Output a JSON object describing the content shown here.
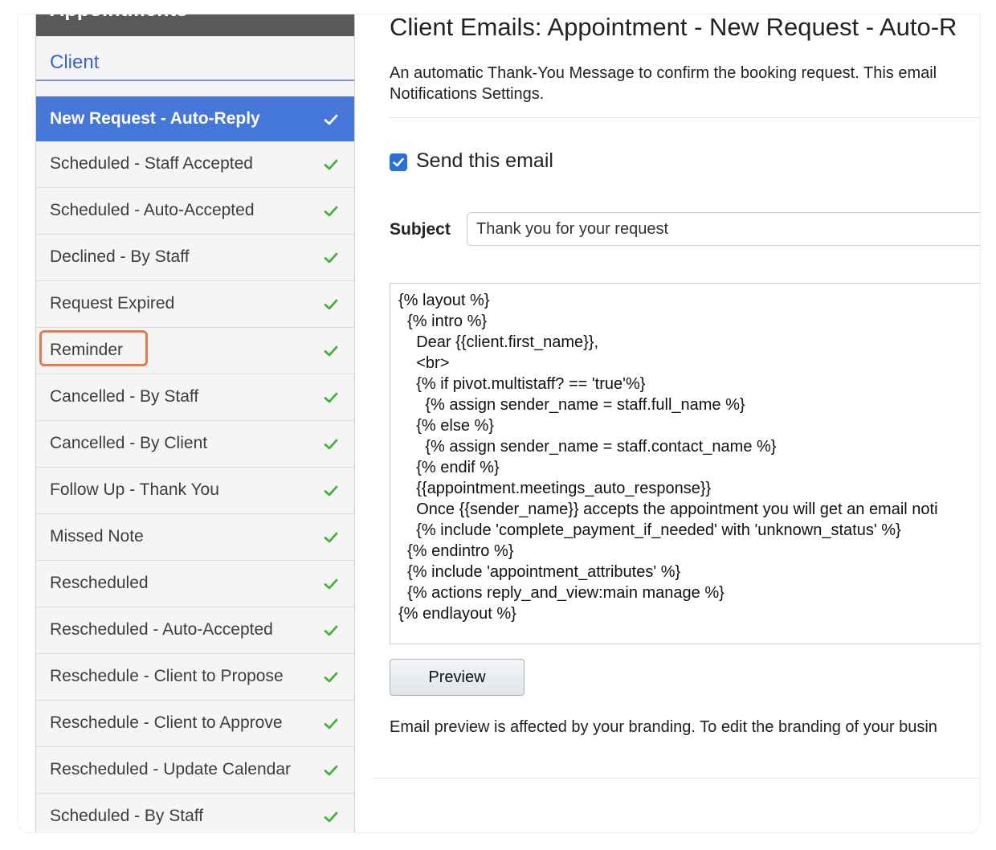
{
  "sidebar": {
    "header": "Appointments",
    "section": "Client",
    "items": [
      {
        "label": "New Request - Auto-Reply"
      },
      {
        "label": "Scheduled - Staff Accepted"
      },
      {
        "label": "Scheduled - Auto-Accepted"
      },
      {
        "label": "Declined - By Staff"
      },
      {
        "label": "Request Expired"
      },
      {
        "label": "Reminder"
      },
      {
        "label": "Cancelled - By Staff"
      },
      {
        "label": "Cancelled - By Client"
      },
      {
        "label": "Follow Up - Thank You"
      },
      {
        "label": "Missed Note"
      },
      {
        "label": "Rescheduled"
      },
      {
        "label": "Rescheduled - Auto-Accepted"
      },
      {
        "label": "Reschedule - Client to Propose"
      },
      {
        "label": "Reschedule - Client to Approve"
      },
      {
        "label": "Rescheduled - Update Calendar"
      },
      {
        "label": "Scheduled - By Staff"
      }
    ],
    "check_icon": "checkmark-icon",
    "active_index": 0,
    "highlighted_index": 5
  },
  "main": {
    "title": "Client Emails: Appointment - New Request - Auto-R",
    "description": "An automatic Thank-You Message to confirm the booking request. This email\nNotifications Settings.",
    "send_label": "Send this email",
    "send_checked": true,
    "subject_label": "Subject",
    "subject_value": "Thank you for your request",
    "body": "{% layout %}\n  {% intro %}\n    Dear {{client.first_name}},\n    <br>\n    {% if pivot.multistaff? == 'true'%}\n      {% assign sender_name = staff.full_name %}\n    {% else %}\n      {% assign sender_name = staff.contact_name %}\n    {% endif %}\n    {{appointment.meetings_auto_response}}\n    Once {{sender_name}} accepts the appointment you will get an email noti\n    {% include 'complete_payment_if_needed' with 'unknown_status' %}\n  {% endintro %}\n  {% include 'appointment_attributes' %}\n  {% actions reply_and_view:main manage %}\n{% endlayout %}",
    "preview_label": "Preview",
    "branding_note": "Email preview is affected by your branding. To edit the branding of your busin"
  },
  "colors": {
    "accent": "#4577d8",
    "check_green": "#3db53d",
    "highlight_border": "#e5794f",
    "section_link": "#3a67c5"
  }
}
